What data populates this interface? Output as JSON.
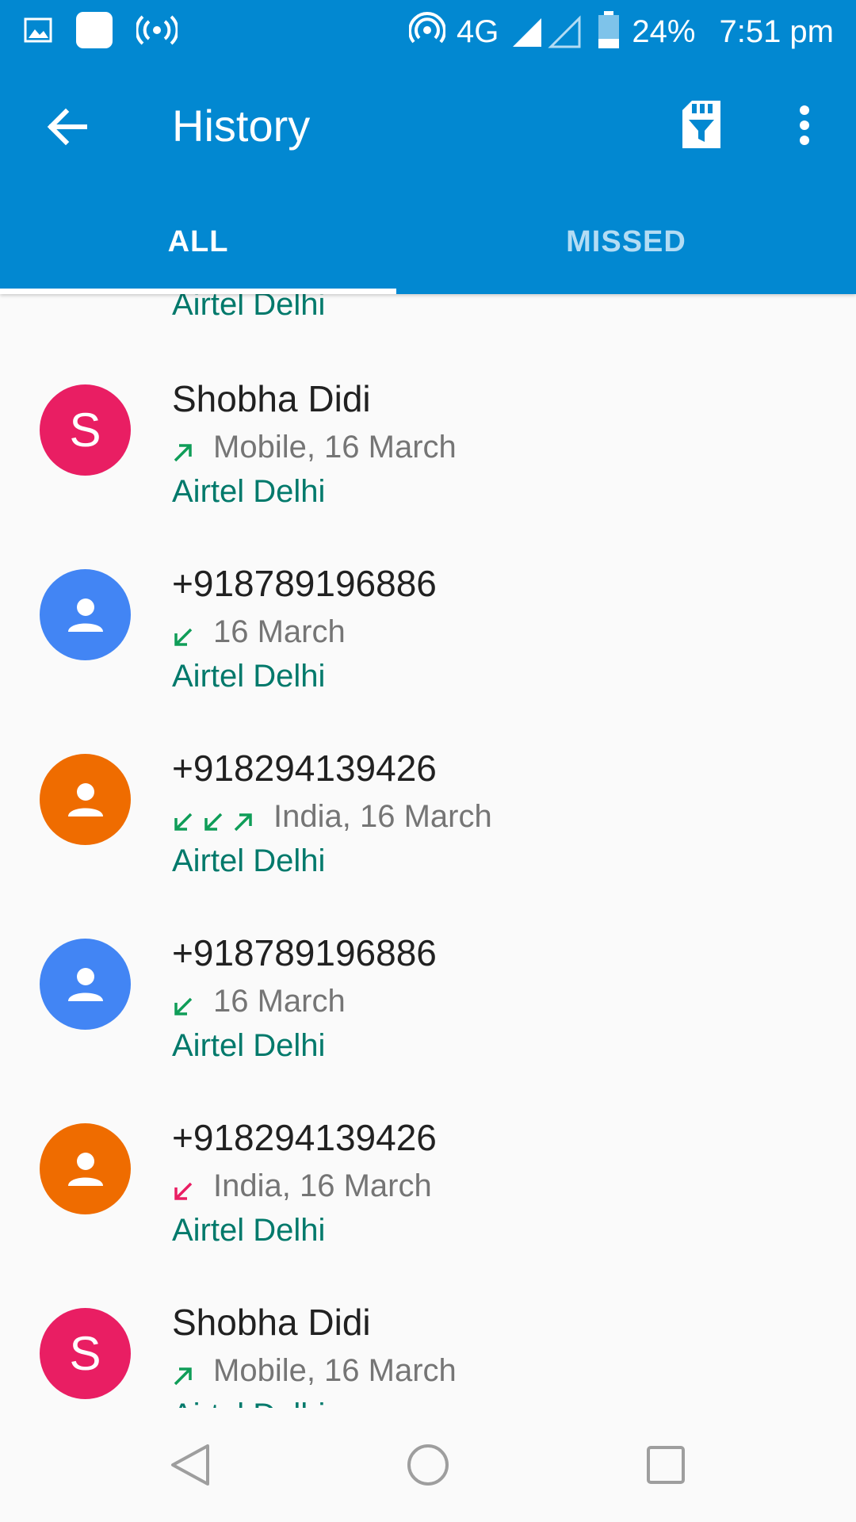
{
  "status_bar": {
    "network": "4G",
    "battery": "24%",
    "time": "7:51 pm",
    "icons": [
      "image-icon",
      "app-icon",
      "hotspot-icon",
      "wifi-calling-icon",
      "signal-icon",
      "battery-icon"
    ]
  },
  "toolbar": {
    "title": "History",
    "icons": [
      "back-arrow-icon",
      "sim-filter-icon",
      "more-vert-icon"
    ]
  },
  "tabs": {
    "all": "ALL",
    "missed": "MISSED",
    "active": "ALL"
  },
  "list": {
    "partial_top_account": "Airtel Delhi",
    "items": [
      {
        "name": "Shobha Didi",
        "avatar_letter": "S",
        "avatar_color": "#e91e63",
        "arrows": [
          "outgoing"
        ],
        "detail": "Mobile, 16 March",
        "account": "Airtel Delhi"
      },
      {
        "name": "+918789196886",
        "avatar_letter": "",
        "avatar_color": "#4285f4",
        "arrows": [
          "incoming"
        ],
        "detail": "16 March",
        "account": "Airtel Delhi"
      },
      {
        "name": "+918294139426",
        "avatar_letter": "",
        "avatar_color": "#ef6c00",
        "arrows": [
          "incoming",
          "incoming",
          "outgoing"
        ],
        "detail": "India, 16 March",
        "account": "Airtel Delhi"
      },
      {
        "name": "+918789196886",
        "avatar_letter": "",
        "avatar_color": "#4285f4",
        "arrows": [
          "incoming"
        ],
        "detail": "16 March",
        "account": "Airtel Delhi"
      },
      {
        "name": "+918294139426",
        "avatar_letter": "",
        "avatar_color": "#ef6c00",
        "arrows": [
          "missed"
        ],
        "detail": "India, 16 March",
        "account": "Airtel Delhi"
      },
      {
        "name": "Shobha Didi",
        "avatar_letter": "S",
        "avatar_color": "#e91e63",
        "arrows": [
          "outgoing"
        ],
        "detail": "Mobile, 16 March",
        "account": "Airtel Delhi"
      }
    ]
  },
  "colors": {
    "app_bar": "#0288d1",
    "account_text": "#00796b",
    "arrow_green": "#0f9d58",
    "arrow_red": "#e91e63"
  },
  "nav_bar": {
    "icons": [
      "nav-back-icon",
      "nav-home-icon",
      "nav-recents-icon"
    ]
  }
}
